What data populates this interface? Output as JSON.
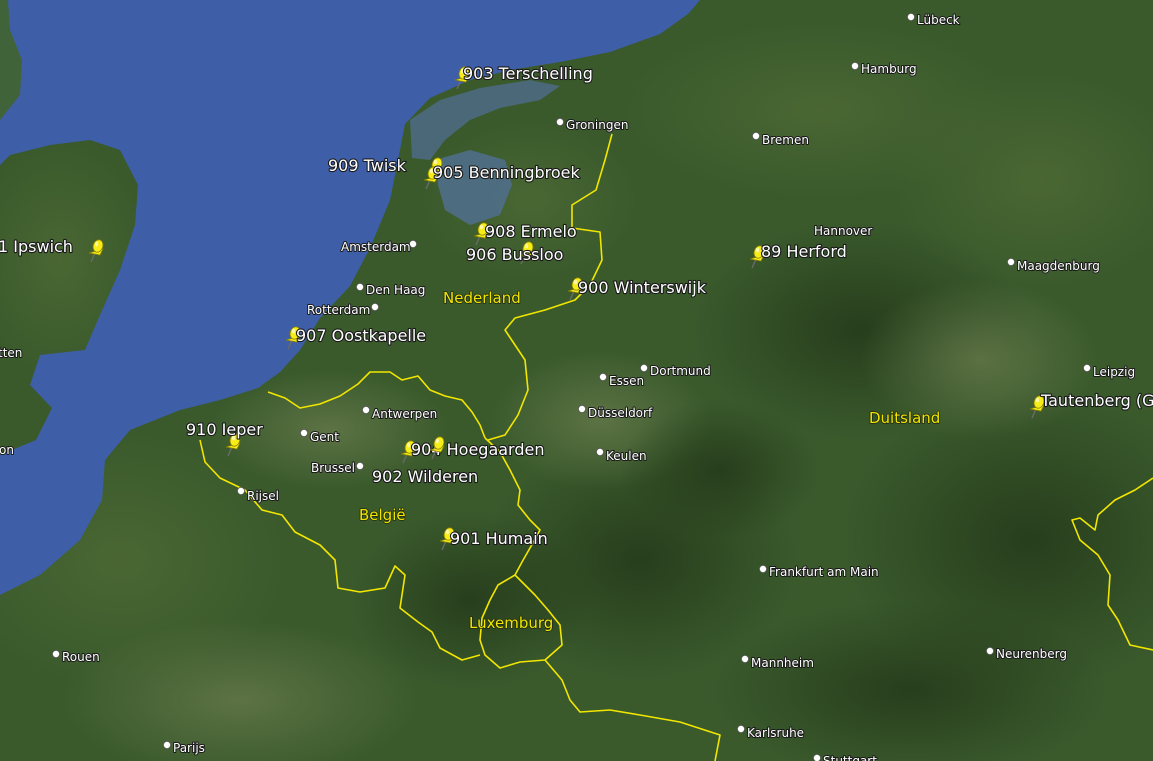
{
  "colors": {
    "sea": "#3e5fa8",
    "land": "#3a5a2c",
    "border": "#f2e600",
    "pin": "#f5ec18",
    "label_text": "#ffffff"
  },
  "placemarks": [
    {
      "id": "terschelling",
      "label": "903 Terschelling"
    },
    {
      "id": "twisk",
      "label": "909 Twisk"
    },
    {
      "id": "benningbroek",
      "label": "905 Benningbroek"
    },
    {
      "id": "ermelo",
      "label": "908 Ermelo"
    },
    {
      "id": "bussloo",
      "label": "906 Bussloo"
    },
    {
      "id": "winterswijk",
      "label": "900 Winterswijk"
    },
    {
      "id": "oostkapelle",
      "label": "907 Oostkapelle"
    },
    {
      "id": "ieper",
      "label": "910 Ieper"
    },
    {
      "id": "hoegaarden",
      "label": "904 Hoegaarden"
    },
    {
      "id": "wilderen",
      "label": "902 Wilderen"
    },
    {
      "id": "humain",
      "label": "901 Humain"
    },
    {
      "id": "herford",
      "label": "89 Herford"
    },
    {
      "id": "ipswich",
      "label": "1 Ipswich"
    },
    {
      "id": "tautenberg",
      "label": "Tautenberg (G"
    }
  ],
  "cities": [
    {
      "id": "lubeck",
      "name": "Lübeck"
    },
    {
      "id": "hamburg",
      "name": "Hamburg"
    },
    {
      "id": "groningen",
      "name": "Groningen"
    },
    {
      "id": "bremen",
      "name": "Bremen"
    },
    {
      "id": "hannover",
      "name": "Hannover"
    },
    {
      "id": "amsterdam",
      "name": "Amsterdam"
    },
    {
      "id": "denhaag",
      "name": "Den Haag"
    },
    {
      "id": "rotterdam",
      "name": "Rotterdam"
    },
    {
      "id": "maagdenburg",
      "name": "Maagdenburg"
    },
    {
      "id": "essen",
      "name": "Essen"
    },
    {
      "id": "dortmund",
      "name": "Dortmund"
    },
    {
      "id": "leipzig",
      "name": "Leipzig"
    },
    {
      "id": "antwerpen",
      "name": "Antwerpen"
    },
    {
      "id": "gent",
      "name": "Gent"
    },
    {
      "id": "dusseldorf",
      "name": "Düsseldorf"
    },
    {
      "id": "brussel",
      "name": "Brussel"
    },
    {
      "id": "keulen",
      "name": "Keulen"
    },
    {
      "id": "rijsel",
      "name": "Rijsel"
    },
    {
      "id": "frankfurt",
      "name": "Frankfurt am Main"
    },
    {
      "id": "rouen",
      "name": "Rouen"
    },
    {
      "id": "mannheim",
      "name": "Mannheim"
    },
    {
      "id": "neurenberg",
      "name": "Neurenberg"
    },
    {
      "id": "parijs",
      "name": "Parijs"
    },
    {
      "id": "karlsruhe",
      "name": "Karlsruhe"
    },
    {
      "id": "stuttgart",
      "name": "Stuttgart"
    },
    {
      "id": "edge_tten",
      "name": "tten"
    },
    {
      "id": "edge_on",
      "name": "on"
    }
  ],
  "countries": [
    {
      "id": "nederland",
      "name": "Nederland"
    },
    {
      "id": "duitsland",
      "name": "Duitsland"
    },
    {
      "id": "belgie",
      "name": "België"
    },
    {
      "id": "luxemburg",
      "name": "Luxemburg"
    }
  ]
}
